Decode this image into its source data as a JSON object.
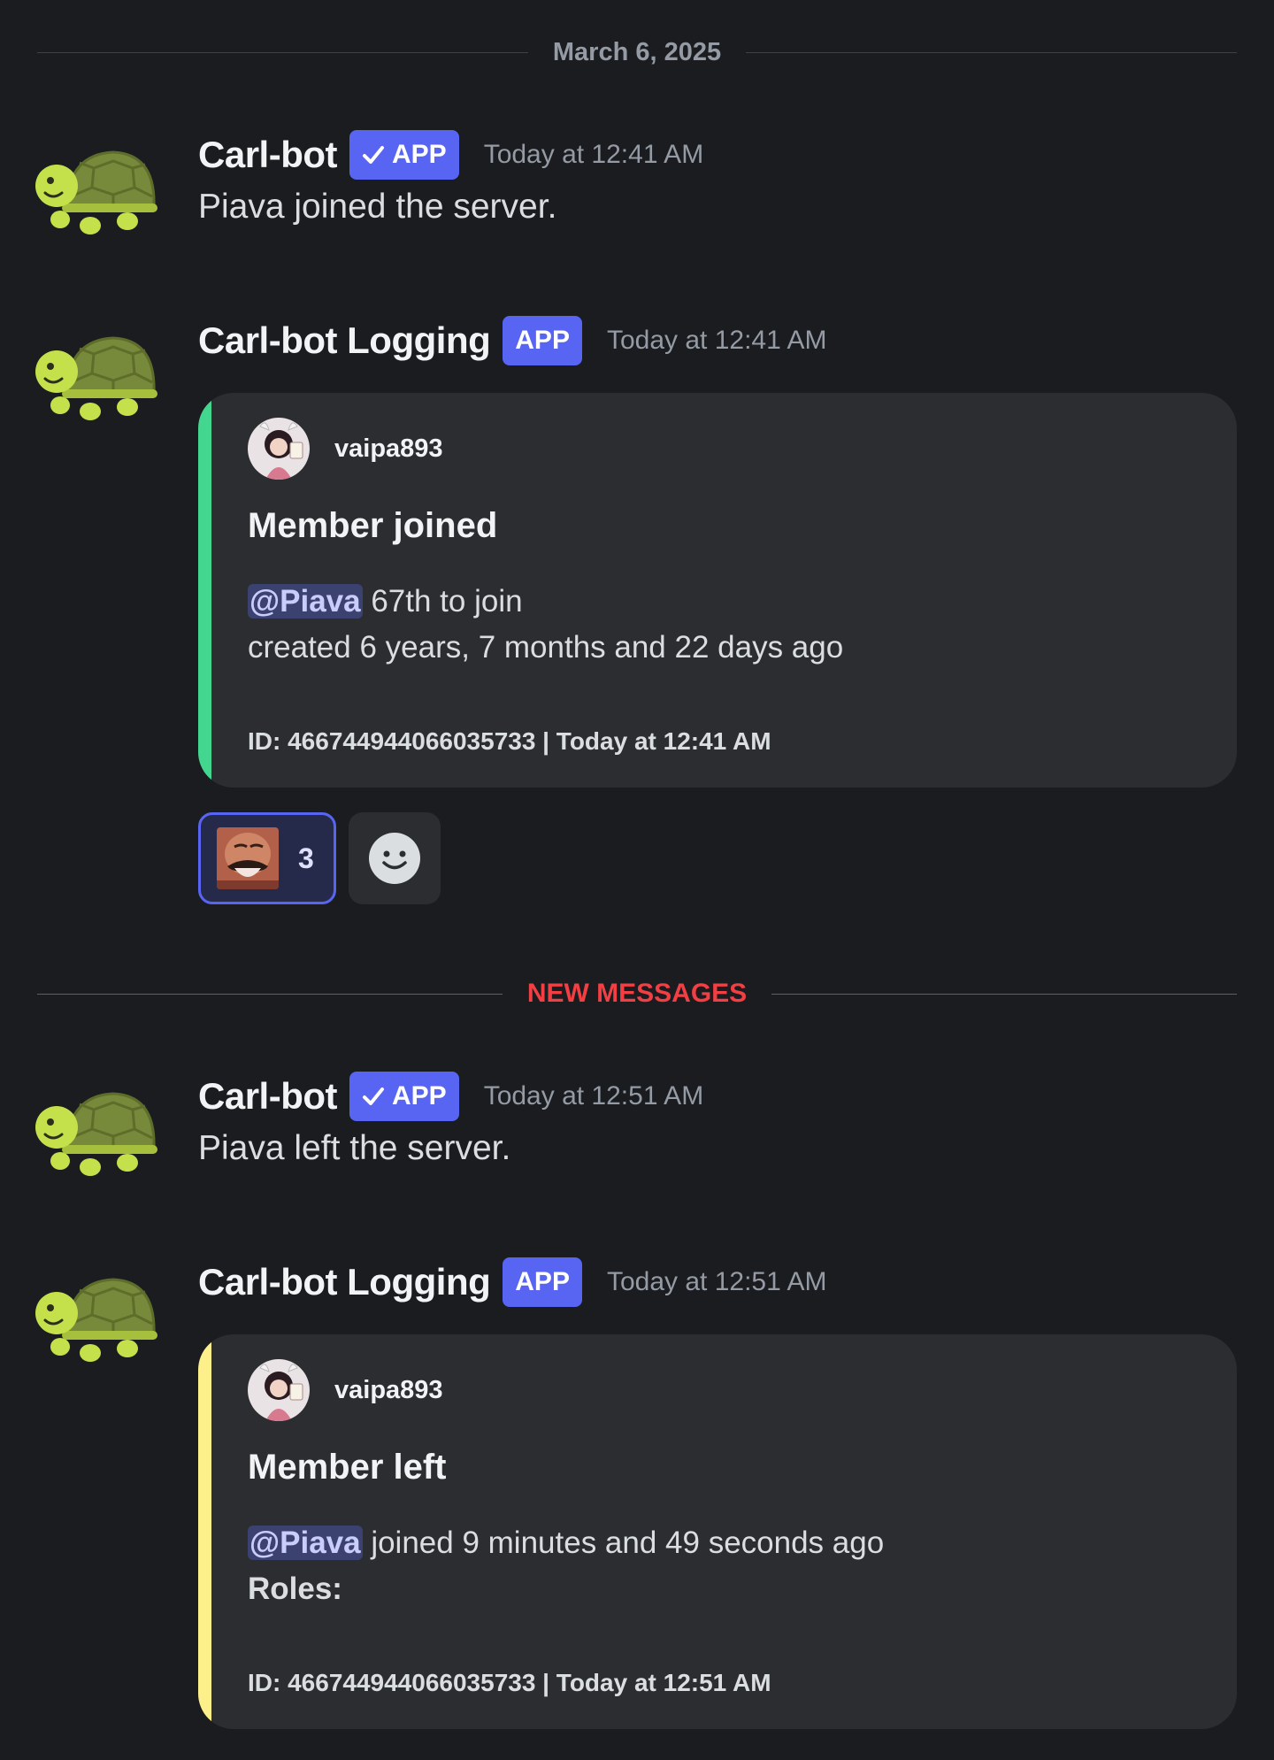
{
  "date_divider": "March 6, 2025",
  "new_divider": "NEW MESSAGES",
  "messages": [
    {
      "author": "Carl-bot",
      "tag": "APP",
      "verified": true,
      "time": "Today at 12:41 AM",
      "text": "Piava joined the server."
    },
    {
      "author": "Carl-bot Logging",
      "tag": "APP",
      "verified": false,
      "time": "Today at 12:41 AM",
      "embed": {
        "color": "#43d68f",
        "author": "vaipa893",
        "title": "Member joined",
        "mention": "@Piava",
        "line1_rest": " 67th to join",
        "line2": "created 6 years, 7 months and 22 days ago",
        "footer": "ID: 466744944066035733 | Today at 12:41 AM"
      },
      "reaction": {
        "count": "3",
        "emoji": "laughing-face-emoji"
      }
    },
    {
      "author": "Carl-bot",
      "tag": "APP",
      "verified": true,
      "time": "Today at 12:51 AM",
      "text": "Piava left the server."
    },
    {
      "author": "Carl-bot Logging",
      "tag": "APP",
      "verified": false,
      "time": "Today at 12:51 AM",
      "embed": {
        "color": "#fdf08a",
        "author": "vaipa893",
        "title": "Member left",
        "mention": "@Piava",
        "line1_rest": " joined 9 minutes and 49 seconds ago",
        "line2": "Roles:",
        "footer": "ID: 466744944066035733 | Today at 12:51 AM"
      }
    }
  ],
  "icons": {
    "avatar": "turtle-icon",
    "verified": "checkmark-icon",
    "add_reaction": "smiley-icon"
  },
  "colors": {
    "background": "#1b1c20",
    "accent": "#5865f2",
    "new_messages": "#f23f43"
  }
}
